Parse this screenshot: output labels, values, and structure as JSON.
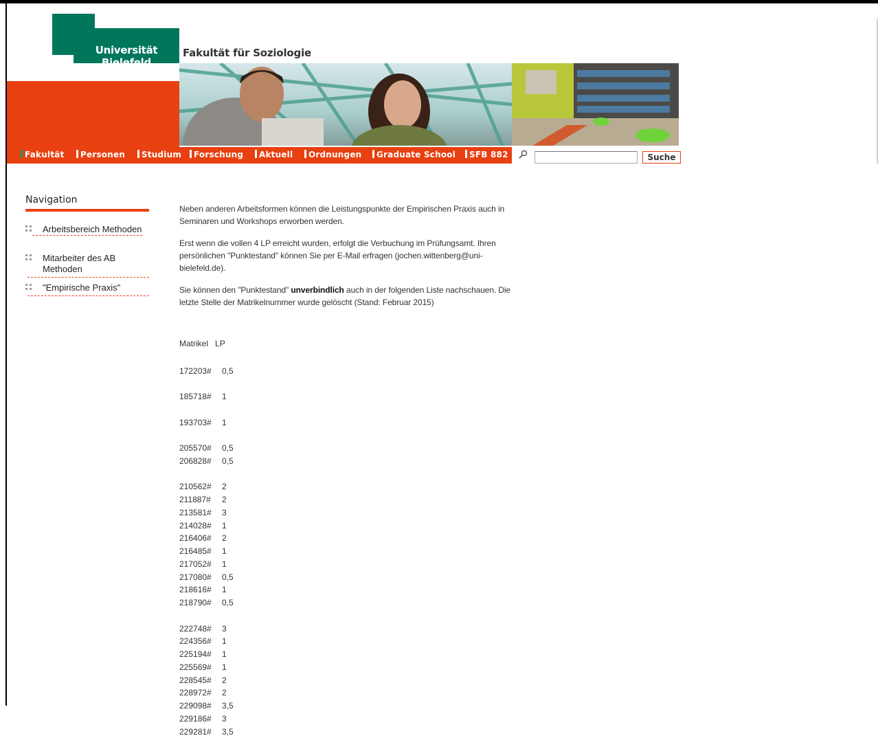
{
  "header": {
    "logo_text": "Universität Bielefeld",
    "faculty_title": "Fakultät für Soziologie"
  },
  "colors": {
    "brand_green": "#00775b",
    "accent_orange": "#e84010"
  },
  "nav": {
    "items": [
      {
        "label": "Fakultät"
      },
      {
        "label": "Personen"
      },
      {
        "label": "Studium"
      },
      {
        "label": "Forschung"
      },
      {
        "label": "Aktuell"
      },
      {
        "label": "Ordnungen"
      },
      {
        "label": "Graduate School"
      },
      {
        "label": "SFB 882"
      }
    ]
  },
  "search": {
    "icon": "search-icon",
    "value": "",
    "button_label": "Suche"
  },
  "sidebar": {
    "title": "Navigation",
    "items": [
      {
        "label": "Arbeitsbereich Methoden"
      },
      {
        "label": "Mitarbeiter des AB Methoden"
      },
      {
        "label": "\"Empirische Praxis\""
      }
    ]
  },
  "content": {
    "p1": "Neben anderen Arbeitsformen können die Leistungspunkte der Empirischen Praxis auch in Seminaren und Workshops erworben werden.",
    "p2": "Erst wenn die  vollen 4 LP erreicht wurden, erfolgt die Verbuchung im Prüfungsamt. Ihren persönlichen \"Punktestand\" können Sie per E-Mail erfragen (jochen.wittenberg@uni-bielefeld.de).",
    "p3_before": "Sie können den \"Punktestand\" ",
    "p3_bold": "unverbindlich",
    "p3_after": " auch in der folgenden Liste nachschauen. Die letzte Stelle der Matrikelnummer wurde gelöscht (Stand: Februar 2015)"
  },
  "table": {
    "header_matrikel": "Matrikel",
    "header_lp": "LP",
    "rows": [
      {
        "m": "172203#",
        "lp": "0,5"
      },
      {
        "m": "185718#",
        "lp": "1"
      },
      {
        "m": "193703#",
        "lp": "1"
      },
      {
        "m": "205570#",
        "lp": "0,5"
      },
      {
        "m": "206828#",
        "lp": "0,5"
      },
      {
        "m": "210562#",
        "lp": "2"
      },
      {
        "m": "211887#",
        "lp": "2"
      },
      {
        "m": "213581#",
        "lp": "3"
      },
      {
        "m": "214028#",
        "lp": "1"
      },
      {
        "m": "216406#",
        "lp": "2"
      },
      {
        "m": "216485#",
        "lp": "1"
      },
      {
        "m": "217052#",
        "lp": "1"
      },
      {
        "m": "217080#",
        "lp": "0,5"
      },
      {
        "m": "218616#",
        "lp": "1"
      },
      {
        "m": "218790#",
        "lp": "0,5"
      },
      {
        "m": "222748#",
        "lp": "3"
      },
      {
        "m": "224356#",
        "lp": "1"
      },
      {
        "m": "225194#",
        "lp": "1"
      },
      {
        "m": "225569#",
        "lp": "1"
      },
      {
        "m": "228545#",
        "lp": "2"
      },
      {
        "m": "228972#",
        "lp": "2"
      },
      {
        "m": "229098#",
        "lp": "3,5"
      },
      {
        "m": "229186#",
        "lp": "3"
      },
      {
        "m": "229281#",
        "lp": "3,5"
      }
    ]
  }
}
